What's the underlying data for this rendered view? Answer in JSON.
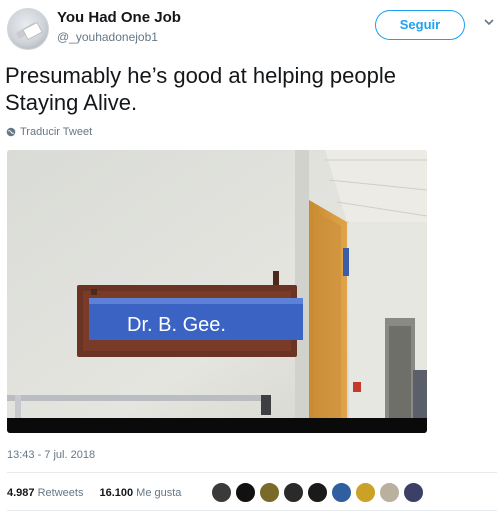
{
  "user": {
    "name": "You Had One Job",
    "handle": "@_youhadonejob1"
  },
  "follow_label": "Seguir",
  "tweet": {
    "text": "Presumably he’s good at helping people Staying Alive.",
    "translate_label": "Traducir Tweet"
  },
  "media": {
    "sign_text": "Dr. B. Gee."
  },
  "meta": {
    "timestamp": "13:43 - 7 jul. 2018"
  },
  "stats": {
    "retweets_count": "4.987",
    "retweets_label": "Retweets",
    "likes_count": "16.100",
    "likes_label": "Me gusta"
  },
  "likers": [
    {
      "color": "#3a3a3a"
    },
    {
      "color": "#111111"
    },
    {
      "color": "#7a6a2a"
    },
    {
      "color": "#2a2a2a"
    },
    {
      "color": "#1a1a1a"
    },
    {
      "color": "#2f5fa0"
    },
    {
      "color": "#c9a227"
    },
    {
      "color": "#b9b19e"
    },
    {
      "color": "#3c3f66"
    }
  ],
  "colors": {
    "accent": "#1da1f2",
    "secondary_text": "#657786",
    "sign_blue": "#3a63c4"
  }
}
